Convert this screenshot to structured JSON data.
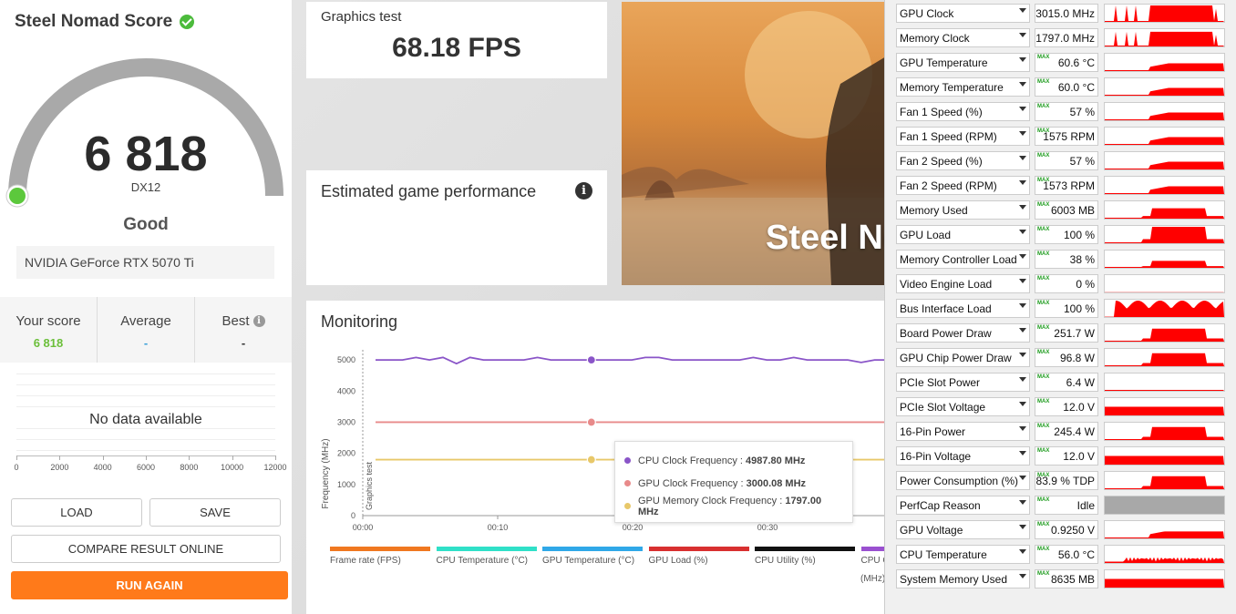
{
  "left": {
    "title": "Steel Nomad Score",
    "score": "6 818",
    "api": "DX12",
    "rating": "Good",
    "gpu_name": "NVIDIA GeForce RTX 5070 Ti",
    "gauge_color": "#a9a9a9",
    "gauge_dot_color": "#5cc83c",
    "stats": [
      {
        "label": "Your score",
        "value": "6 818",
        "color": "#6bbf3a"
      },
      {
        "label": "Average",
        "value": "-",
        "color": "#3aa0d8"
      },
      {
        "label": "Best",
        "value": "-",
        "color": "#333333"
      }
    ],
    "no_data": "No data available",
    "x_ticks": [
      "0",
      "2000",
      "4000",
      "6000",
      "8000",
      "10000",
      "12000"
    ],
    "buttons": {
      "load": "LOAD",
      "save": "SAVE",
      "compare": "COMPARE RESULT ONLINE",
      "run_again": "RUN AGAIN"
    },
    "accent": "#ff7a1a"
  },
  "graphics_test": {
    "label": "Graphics test",
    "value": "68.18 FPS"
  },
  "estimated": {
    "title": "Estimated game performance"
  },
  "hero": {
    "title": "Steel Nomad"
  },
  "monitoring": {
    "title": "Monitoring",
    "y_label": "Frequency (MHz)",
    "band_label": "Graphics test",
    "tooltip": [
      {
        "label": "CPU Clock Frequency : ",
        "value": "4987.80 MHz",
        "color": "#8a55c8"
      },
      {
        "label": "GPU Clock Frequency : ",
        "value": "3000.08 MHz",
        "color": "#e88a8a"
      },
      {
        "label": "GPU Memory Clock Frequency : ",
        "value": "1797.00 MHz",
        "color": "#e8c86a"
      }
    ],
    "legend": [
      {
        "label": "Frame rate (FPS)",
        "color": "#f07820"
      },
      {
        "label": "CPU Temperature (°C)",
        "color": "#30e0c8"
      },
      {
        "label": "GPU Temperature (°C)",
        "color": "#30a8e8"
      },
      {
        "label": "GPU Load (%)",
        "color": "#d83030"
      },
      {
        "label": "CPU Utility (%)",
        "color": "#111111"
      },
      {
        "label": "CPU C",
        "color": "#9a50d0"
      }
    ],
    "legend_extra": "(MHz)",
    "chart_data": {
      "type": "line",
      "x_ticks": [
        "00:00",
        "00:10",
        "00:20",
        "00:30"
      ],
      "y_ticks": [
        "0",
        "1000",
        "2000",
        "3000",
        "4000",
        "5000"
      ],
      "ylim": [
        0,
        5500
      ],
      "series": [
        {
          "name": "CPU Clock Frequency",
          "color": "#8a55c8",
          "values": [
            5000,
            5000,
            5000,
            5080,
            5000,
            5080,
            4880,
            5080,
            5000,
            5000,
            5000,
            5000,
            5080,
            5000,
            5000,
            5000,
            5000,
            5000,
            5000,
            5000,
            5080,
            5080,
            5000,
            5000,
            5000,
            5000,
            5000,
            5000,
            5080,
            5000,
            5000,
            5080,
            5000,
            5000,
            5000,
            5000,
            4920,
            5000,
            5000
          ]
        },
        {
          "name": "GPU Clock Frequency",
          "color": "#e88a8a",
          "values": [
            3000,
            3000,
            3000,
            3000,
            3000,
            3000,
            3000,
            3000,
            3000,
            3000,
            3000,
            3000,
            3000,
            3000,
            3000,
            3000,
            3000,
            3000,
            3000,
            3000,
            3000,
            3000,
            3000,
            3000,
            3000,
            3000,
            3000,
            3000,
            3000,
            3000,
            3000,
            3000,
            3000,
            3000,
            3000,
            3000,
            3000,
            3000,
            3000
          ]
        },
        {
          "name": "GPU Memory Clock Frequency",
          "color": "#e8c86a",
          "values": [
            1797,
            1797,
            1797,
            1797,
            1797,
            1797,
            1797,
            1797,
            1797,
            1797,
            1797,
            1797,
            1797,
            1797,
            1797,
            1797,
            1797,
            1797,
            1797,
            1797,
            1797,
            1797,
            1797,
            1797,
            1797,
            1797,
            1797,
            1797,
            1797,
            1797,
            1797,
            1797,
            1797,
            1797,
            1797,
            1797,
            1797,
            1797,
            1797
          ]
        }
      ]
    }
  },
  "sensors": [
    {
      "name": "GPU Clock",
      "value": "3015.0 MHz",
      "max": false,
      "level": 0.95,
      "pattern": "spiky"
    },
    {
      "name": "Memory Clock",
      "value": "1797.0 MHz",
      "max": false,
      "level": 0.85,
      "pattern": "spiky"
    },
    {
      "name": "GPU Temperature",
      "value": "60.6 °C",
      "max": true,
      "level": 0.45,
      "pattern": "ramp"
    },
    {
      "name": "Memory Temperature",
      "value": "60.0 °C",
      "max": true,
      "level": 0.45,
      "pattern": "ramp"
    },
    {
      "name": "Fan 1 Speed (%)",
      "value": "57 %",
      "max": true,
      "level": 0.45,
      "pattern": "ramp"
    },
    {
      "name": "Fan 1 Speed (RPM)",
      "value": "1575 RPM",
      "max": true,
      "level": 0.45,
      "pattern": "ramp"
    },
    {
      "name": "Fan 2 Speed (%)",
      "value": "57 %",
      "max": true,
      "level": 0.45,
      "pattern": "ramp"
    },
    {
      "name": "Fan 2 Speed (RPM)",
      "value": "1573 RPM",
      "max": true,
      "level": 0.45,
      "pattern": "ramp"
    },
    {
      "name": "Memory Used",
      "value": "6003 MB",
      "max": true,
      "level": 0.6,
      "pattern": "block"
    },
    {
      "name": "GPU Load",
      "value": "100 %",
      "max": true,
      "level": 0.95,
      "pattern": "block"
    },
    {
      "name": "Memory Controller Load",
      "value": "38 %",
      "max": true,
      "level": 0.4,
      "pattern": "block"
    },
    {
      "name": "Video Engine Load",
      "value": "0 %",
      "max": true,
      "level": 0,
      "pattern": "flat"
    },
    {
      "name": "Bus Interface Load",
      "value": "100 %",
      "max": true,
      "level": 0.95,
      "pattern": "noisy"
    },
    {
      "name": "Board Power Draw",
      "value": "251.7 W",
      "max": true,
      "level": 0.75,
      "pattern": "block"
    },
    {
      "name": "GPU Chip Power Draw",
      "value": "96.8 W",
      "max": true,
      "level": 0.75,
      "pattern": "block"
    },
    {
      "name": "PCIe Slot Power",
      "value": "6.4 W",
      "max": true,
      "level": 0.05,
      "pattern": "flat"
    },
    {
      "name": "PCIe Slot Voltage",
      "value": "12.0 V",
      "max": true,
      "level": 0.5,
      "pattern": "full"
    },
    {
      "name": "16-Pin Power",
      "value": "245.4 W",
      "max": true,
      "level": 0.75,
      "pattern": "block"
    },
    {
      "name": "16-Pin Voltage",
      "value": "12.0 V",
      "max": true,
      "level": 0.5,
      "pattern": "full"
    },
    {
      "name": "Power Consumption (%)",
      "value": "83.9 % TDP",
      "max": true,
      "level": 0.75,
      "pattern": "block"
    },
    {
      "name": "PerfCap Reason",
      "value": "Idle",
      "max": true,
      "level": 1,
      "pattern": "gray"
    },
    {
      "name": "GPU Voltage",
      "value": "0.9250 V",
      "max": true,
      "level": 0.4,
      "pattern": "ramp"
    },
    {
      "name": "CPU Temperature",
      "value": "56.0 °C",
      "max": true,
      "level": 0.25,
      "pattern": "noisy-low"
    },
    {
      "name": "System Memory Used",
      "value": "8635 MB",
      "max": true,
      "level": 0.5,
      "pattern": "full"
    }
  ],
  "sensor_color": "#ff0000"
}
